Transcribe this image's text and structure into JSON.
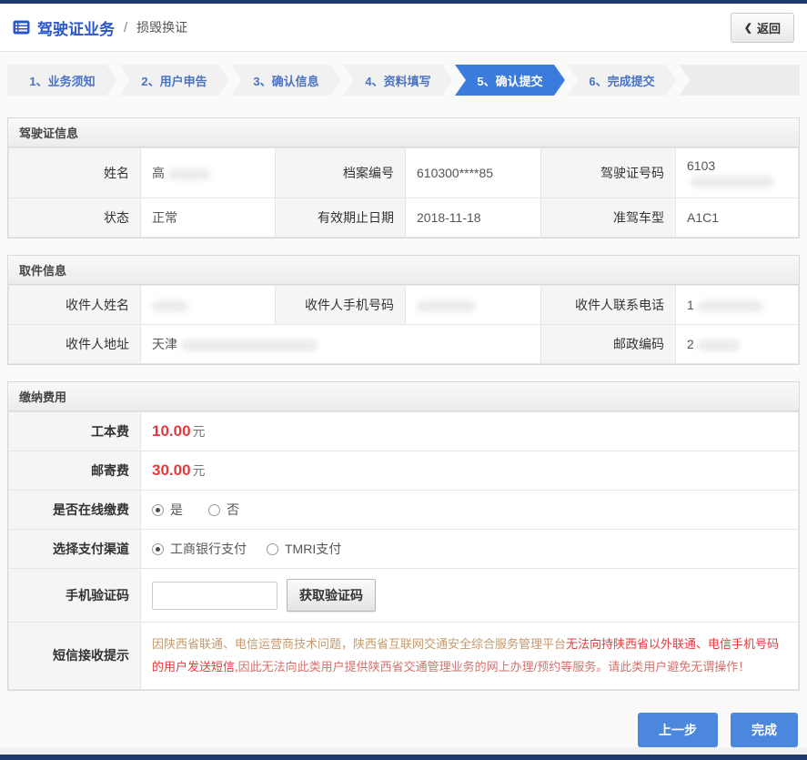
{
  "header": {
    "title": "驾驶证业务",
    "separator": "/",
    "subtitle": "损毁换证",
    "back_icon": "❮",
    "back_label": "返回"
  },
  "stepper": {
    "steps": [
      {
        "label": "1、业务须知",
        "active": false
      },
      {
        "label": "2、用户申告",
        "active": false
      },
      {
        "label": "3、确认信息",
        "active": false
      },
      {
        "label": "4、资料填写",
        "active": false
      },
      {
        "label": "5、确认提交",
        "active": true
      },
      {
        "label": "6、完成提交",
        "active": false
      }
    ]
  },
  "license": {
    "title": "驾驶证信息",
    "name_label": "姓名",
    "name_value": "高",
    "file_no_label": "档案编号",
    "file_no_value": "610300****85",
    "license_no_label": "驾驶证号码",
    "license_no_value": "6103",
    "status_label": "状态",
    "status_value": "正常",
    "expiry_label": "有效期止日期",
    "expiry_value": "2018-11-18",
    "vehicle_label": "准驾车型",
    "vehicle_value": "A1C1"
  },
  "pickup": {
    "title": "取件信息",
    "recipient_label": "收件人姓名",
    "recipient_value": "",
    "mobile_label": "收件人手机号码",
    "mobile_value": "",
    "phone_label": "收件人联系电话",
    "phone_value": "1",
    "address_label": "收件人地址",
    "address_value": "天津",
    "postcode_label": "邮政编码",
    "postcode_value": "2"
  },
  "payment": {
    "title": "缴纳费用",
    "work_fee_label": "工本费",
    "work_fee_value": "10.00",
    "work_fee_unit": "元",
    "post_fee_label": "邮寄费",
    "post_fee_value": "30.00",
    "post_fee_unit": "元",
    "online_label": "是否在线缴费",
    "online_options": [
      {
        "label": "是",
        "selected": true
      },
      {
        "label": "否",
        "selected": false
      }
    ],
    "channel_label": "选择支付渠道",
    "channel_options": [
      {
        "label": "工商银行支付",
        "selected": true
      },
      {
        "label": "TMRI支付",
        "selected": false
      }
    ],
    "captcha_label": "手机验证码",
    "captcha_value": "",
    "captcha_button": "获取验证码",
    "notice_label": "短信接收提示",
    "notice_part1": "因陕西省联通、电信运营商技术问题，陕西省互联网交通安全综合服务管理平台",
    "notice_part2": "无法向持陕西省以外联通、电信手机号码的用户发送短信,",
    "notice_part3": "因此无法向此类用户提供陕西省交通管理业务的网上办理/预约等服务。请此类用户避免无谓操作！"
  },
  "footer": {
    "prev_label": "上一步",
    "finish_label": "完成"
  },
  "colors": {
    "navy": "#1d3a6e",
    "title_blue": "#2b57c8",
    "active_step_blue": "#3b7bdc",
    "button_blue": "#4a87dd",
    "fee_red": "#e4393c",
    "notice_tan": "#c49a6e",
    "notice_red": "#e23c3c"
  }
}
